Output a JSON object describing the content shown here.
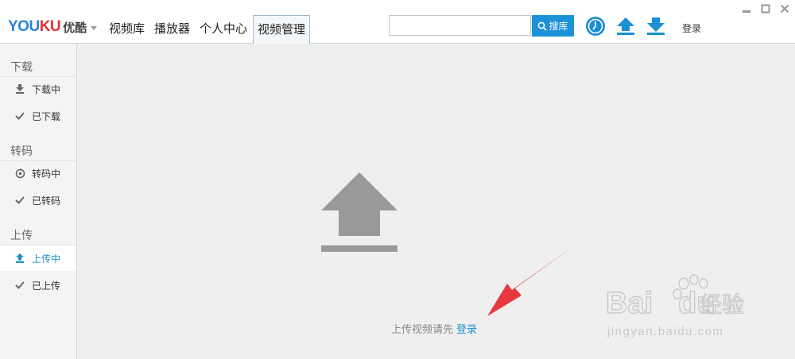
{
  "app": {
    "logo_en_left": "YOU",
    "logo_en_right": "KU",
    "logo_cn": "优酷"
  },
  "nav": {
    "tabs": [
      {
        "label": "视频库"
      },
      {
        "label": "播放器"
      },
      {
        "label": "个人中心"
      },
      {
        "label": "视频管理",
        "active": true
      }
    ]
  },
  "search": {
    "value": "",
    "button_label": "搜库"
  },
  "toolbar": {
    "icons": [
      "clock-icon",
      "upload-icon",
      "download-icon"
    ],
    "login_label": "登录"
  },
  "sidebar": {
    "sections": [
      {
        "title": "下载",
        "items": [
          {
            "label": "下载中",
            "icon": "download-icon"
          },
          {
            "label": "已下载",
            "icon": "check-icon"
          }
        ]
      },
      {
        "title": "转码",
        "items": [
          {
            "label": "转码中",
            "icon": "transcode-icon"
          },
          {
            "label": "已转码",
            "icon": "check-icon"
          }
        ]
      },
      {
        "title": "上传",
        "items": [
          {
            "label": "上传中",
            "icon": "upload-icon",
            "active": true
          },
          {
            "label": "已上传",
            "icon": "check-icon"
          }
        ]
      }
    ]
  },
  "main": {
    "prompt_text": "上传视频请先",
    "prompt_link": "登录"
  },
  "watermark": {
    "brand": "Bai",
    "brand_end": "du",
    "cn": "经验",
    "url": "jingyan.baidu.com"
  },
  "colors": {
    "accent": "#1b8fd2",
    "annotation_arrow": "#e8383d"
  }
}
